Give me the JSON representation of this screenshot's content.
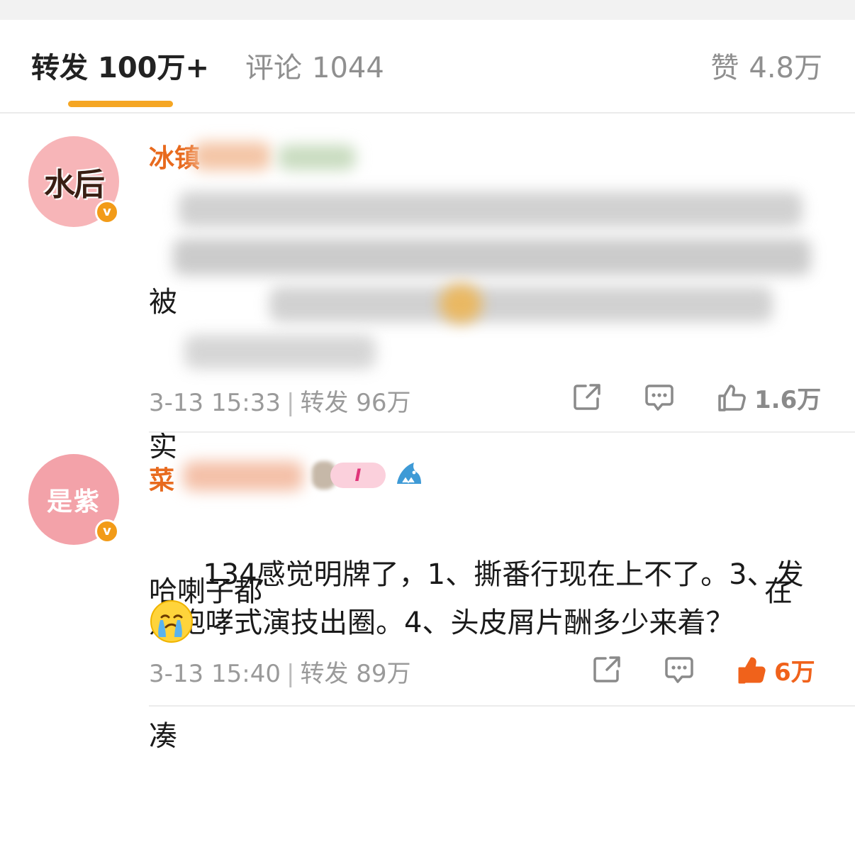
{
  "tabs": {
    "repost": {
      "label": "转发",
      "count": "100万+"
    },
    "comment": {
      "label": "评论",
      "count": "1044"
    },
    "like": {
      "label": "赞",
      "count": "4.8万"
    }
  },
  "comments": [
    {
      "avatar_text": "水后",
      "username_visible": "冰镇",
      "body_visible_lines": [
        "被",
        "实",
        "哈喇子都",
        "凑"
      ],
      "body_visible_tail": "在",
      "time": "3-13 15:33",
      "repost_label": "转发",
      "repost_count": "96万",
      "like_count": "1.6万",
      "liked": false
    },
    {
      "avatar_text": "是紫",
      "username_visible": "菜",
      "body": "134感觉明牌了，1、撕番行现在上不了。3、发点咆哮式演技出圈。4、头皮屑片酬多少来着？",
      "time": "3-13 15:40",
      "repost_label": "转发",
      "repost_count": "89万",
      "like_count": "6万",
      "liked": true
    }
  ],
  "colors": {
    "accent": "#f5a623",
    "username": "#e86a1e",
    "liked": "#f0621b",
    "muted": "#9a9a9a"
  },
  "icons": {
    "share": "share-icon",
    "comment": "comment-bubble-icon",
    "like": "thumbs-up-icon",
    "verified": "verified-badge-icon"
  }
}
